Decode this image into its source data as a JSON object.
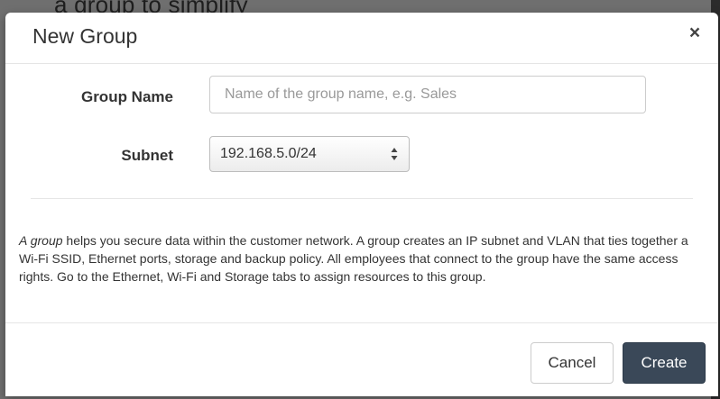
{
  "backdrop": {
    "partial_text": "a group to simplify"
  },
  "dialog": {
    "title": "New Group",
    "close_glyph": "×"
  },
  "form": {
    "group_name": {
      "label": "Group Name",
      "value": "",
      "placeholder": "Name of the group name, e.g. Sales"
    },
    "subnet": {
      "label": "Subnet",
      "selected": "192.168.5.0/24"
    }
  },
  "help": {
    "lead": "A group",
    "body": " helps you secure data within the customer network. A group creates an IP subnet and VLAN that ties together a Wi-Fi SSID, Ethernet ports, storage and backup policy. All employees that connect to the group have the same access rights. Go to the Ethernet, Wi-Fi and Storage tabs to assign resources to this group."
  },
  "footer": {
    "cancel_label": "Cancel",
    "create_label": "Create"
  },
  "colors": {
    "primary_button": "#3a4858",
    "backdrop": "#6f6f6f"
  }
}
